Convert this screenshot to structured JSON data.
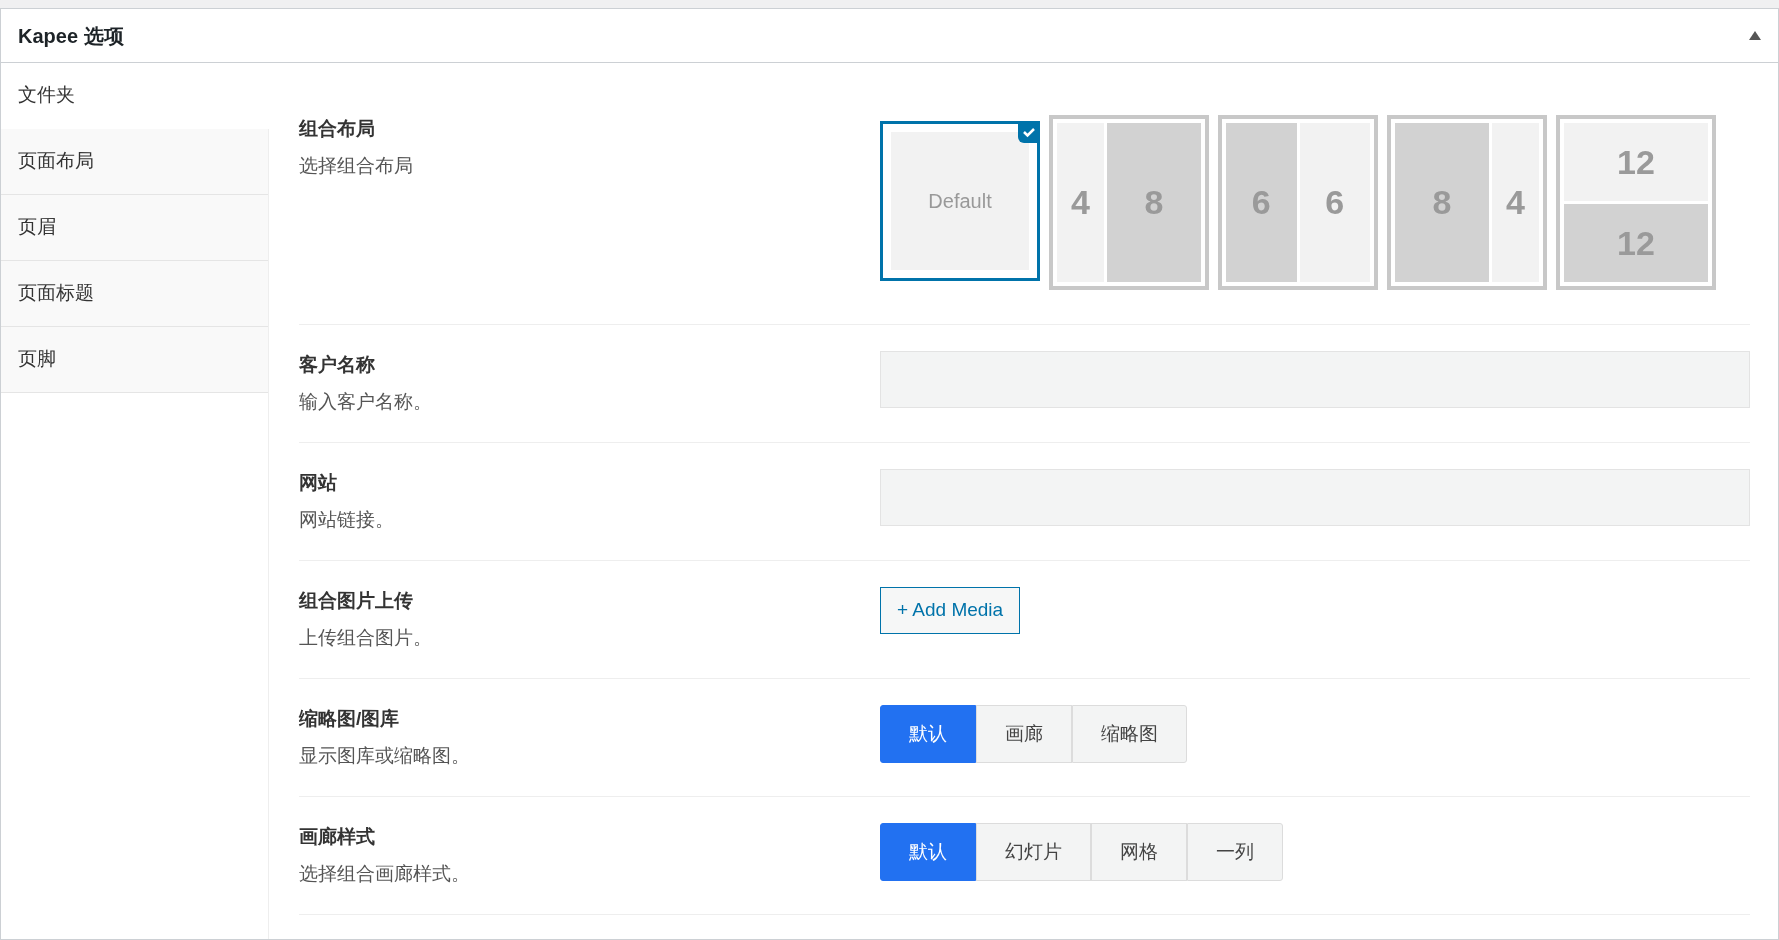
{
  "panel": {
    "title": "Kapee 选项"
  },
  "sidebar": {
    "items": [
      {
        "label": "文件夹",
        "selected": true
      },
      {
        "label": "页面布局",
        "selected": false
      },
      {
        "label": "页眉",
        "selected": false
      },
      {
        "label": "页面标题",
        "selected": false
      },
      {
        "label": "页脚",
        "selected": false
      }
    ]
  },
  "fields": [
    {
      "kind": "layout",
      "label": "组合布局",
      "description": "选择组合布局",
      "options": [
        {
          "selected": true,
          "kind": "single",
          "cells": [
            {
              "label": "Default",
              "shaded": false
            }
          ]
        },
        {
          "selected": false,
          "kind": "narrow-wide",
          "cells": [
            {
              "label": "4",
              "shaded": false
            },
            {
              "label": "8",
              "shaded": true
            }
          ]
        },
        {
          "selected": false,
          "kind": "halves",
          "cells": [
            {
              "label": "6",
              "shaded": true
            },
            {
              "label": "6",
              "shaded": false
            }
          ]
        },
        {
          "selected": false,
          "kind": "wide-narrow",
          "cells": [
            {
              "label": "8",
              "shaded": true
            },
            {
              "label": "4",
              "shaded": false
            }
          ]
        },
        {
          "selected": false,
          "kind": "stacked",
          "cells": [
            {
              "label": "12",
              "shaded": false
            },
            {
              "label": "12",
              "shaded": true
            }
          ]
        }
      ]
    },
    {
      "kind": "text",
      "label": "客户名称",
      "description": "输入客户名称。"
    },
    {
      "kind": "text",
      "label": "网站",
      "description": "网站链接。"
    },
    {
      "kind": "media",
      "label": "组合图片上传",
      "description": "上传组合图片。",
      "button": "+ Add Media"
    },
    {
      "kind": "choice",
      "label": "缩略图/图库",
      "description": "显示图库或缩略图。",
      "choices": [
        {
          "label": "默认",
          "selected": true
        },
        {
          "label": "画廊",
          "selected": false
        },
        {
          "label": "缩略图",
          "selected": false
        }
      ]
    },
    {
      "kind": "choice",
      "label": "画廊样式",
      "description": "选择组合画廊样式。",
      "choices": [
        {
          "label": "默认",
          "selected": true
        },
        {
          "label": "幻灯片",
          "selected": false
        },
        {
          "label": "网格",
          "selected": false
        },
        {
          "label": "一列",
          "selected": false
        }
      ]
    }
  ]
}
